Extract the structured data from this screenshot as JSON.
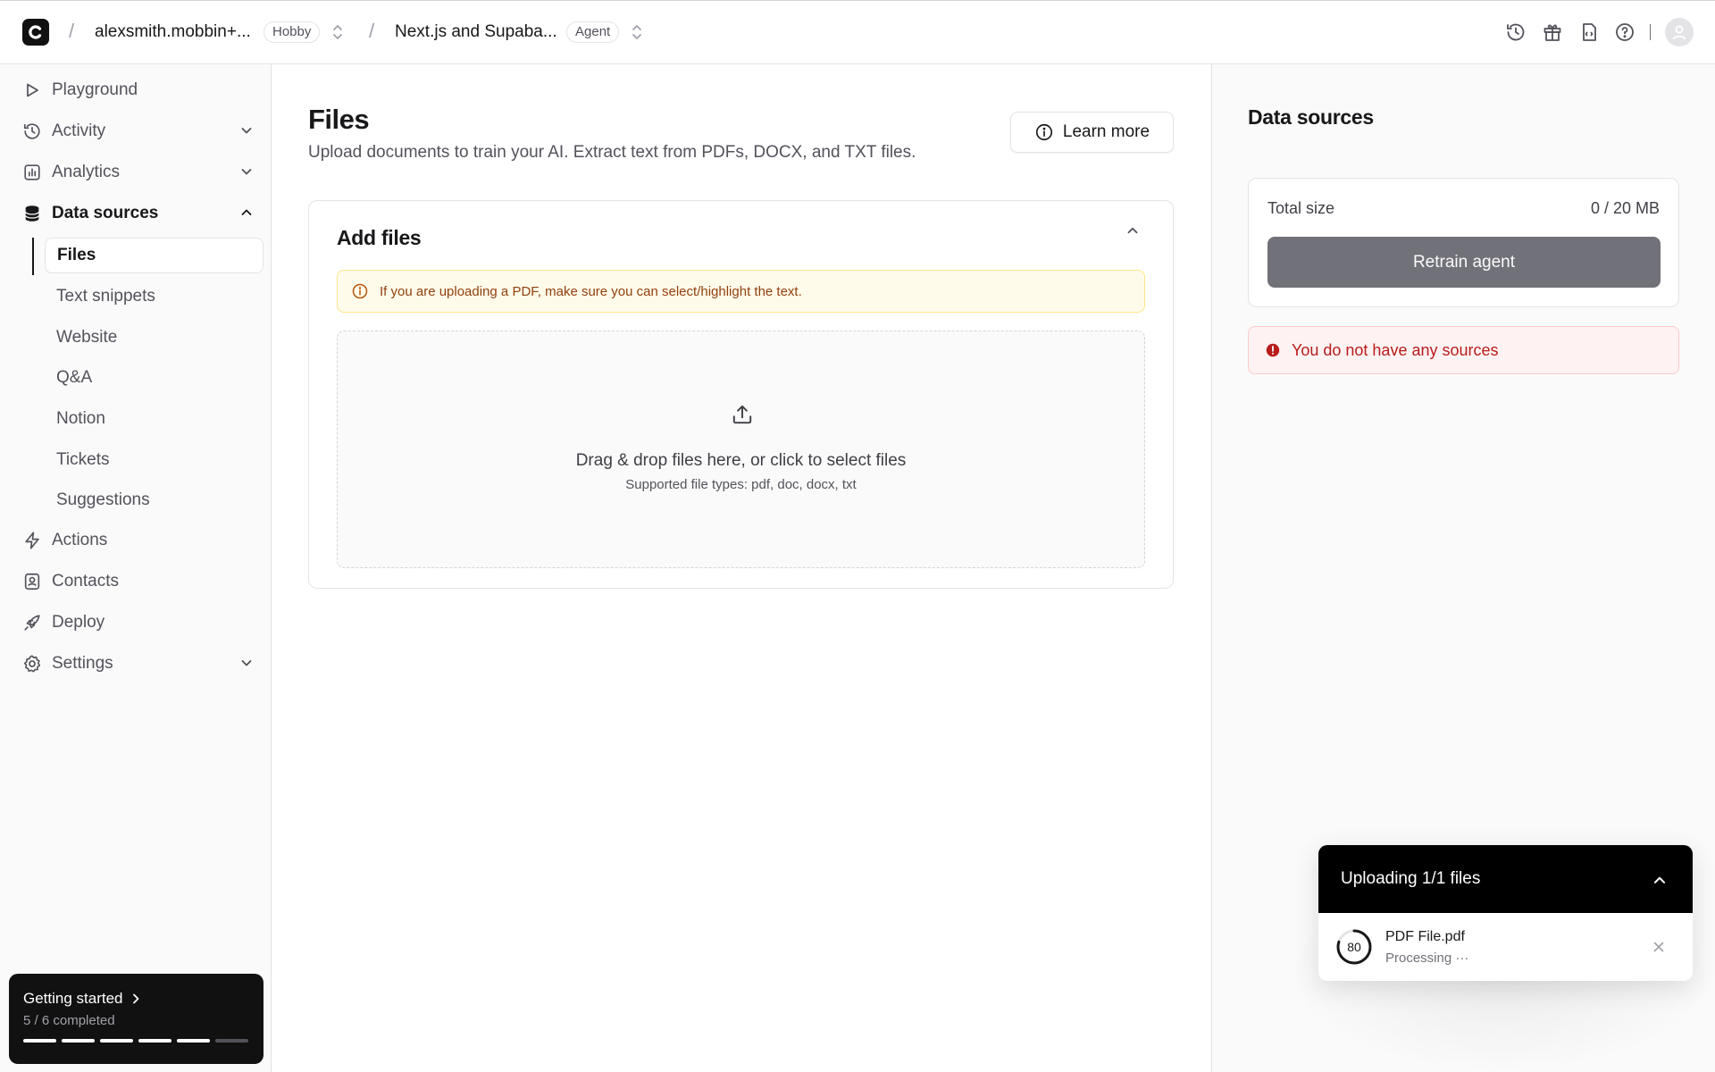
{
  "topbar": {
    "workspace": "alexsmith.mobbin+...",
    "plan_badge": "Hobby",
    "project": "Next.js and Supaba...",
    "project_badge": "Agent"
  },
  "sidebar": {
    "items": [
      {
        "label": "Playground",
        "icon": "play-icon"
      },
      {
        "label": "Activity",
        "icon": "history-icon"
      },
      {
        "label": "Analytics",
        "icon": "chart-icon"
      },
      {
        "label": "Data sources",
        "icon": "database-icon"
      },
      {
        "label": "Actions",
        "icon": "bolt-icon"
      },
      {
        "label": "Contacts",
        "icon": "contact-icon"
      },
      {
        "label": "Deploy",
        "icon": "rocket-icon"
      },
      {
        "label": "Settings",
        "icon": "gear-icon"
      }
    ],
    "sub_items": [
      {
        "label": "Files"
      },
      {
        "label": "Text snippets"
      },
      {
        "label": "Website"
      },
      {
        "label": "Q&A"
      },
      {
        "label": "Notion"
      },
      {
        "label": "Tickets"
      },
      {
        "label": "Suggestions"
      }
    ],
    "getting_started": {
      "title": "Getting started",
      "progress": "5 / 6 completed",
      "completed": 5,
      "total": 6
    }
  },
  "main": {
    "title": "Files",
    "description": "Upload documents to train your AI. Extract text from PDFs, DOCX, and TXT files.",
    "learn_more": "Learn more",
    "card_title": "Add files",
    "warning": "If you are uploading a PDF, make sure you can select/highlight the text.",
    "dropzone_title": "Drag & drop files here, or click to select files",
    "dropzone_sub": "Supported file types: pdf, doc, docx, txt"
  },
  "right_panel": {
    "title": "Data sources",
    "total_size_label": "Total size",
    "total_size_value": "0 / 20 MB",
    "retrain_button": "Retrain agent",
    "error": "You do not have any sources"
  },
  "upload": {
    "header": "Uploading 1/1 files",
    "file_name": "PDF File.pdf",
    "status": "Processing ···",
    "progress": "80",
    "progress_percent": 80
  },
  "colors": {
    "accent": "#18181b",
    "warning_text": "#92400e",
    "error_text": "#b91c1c"
  }
}
